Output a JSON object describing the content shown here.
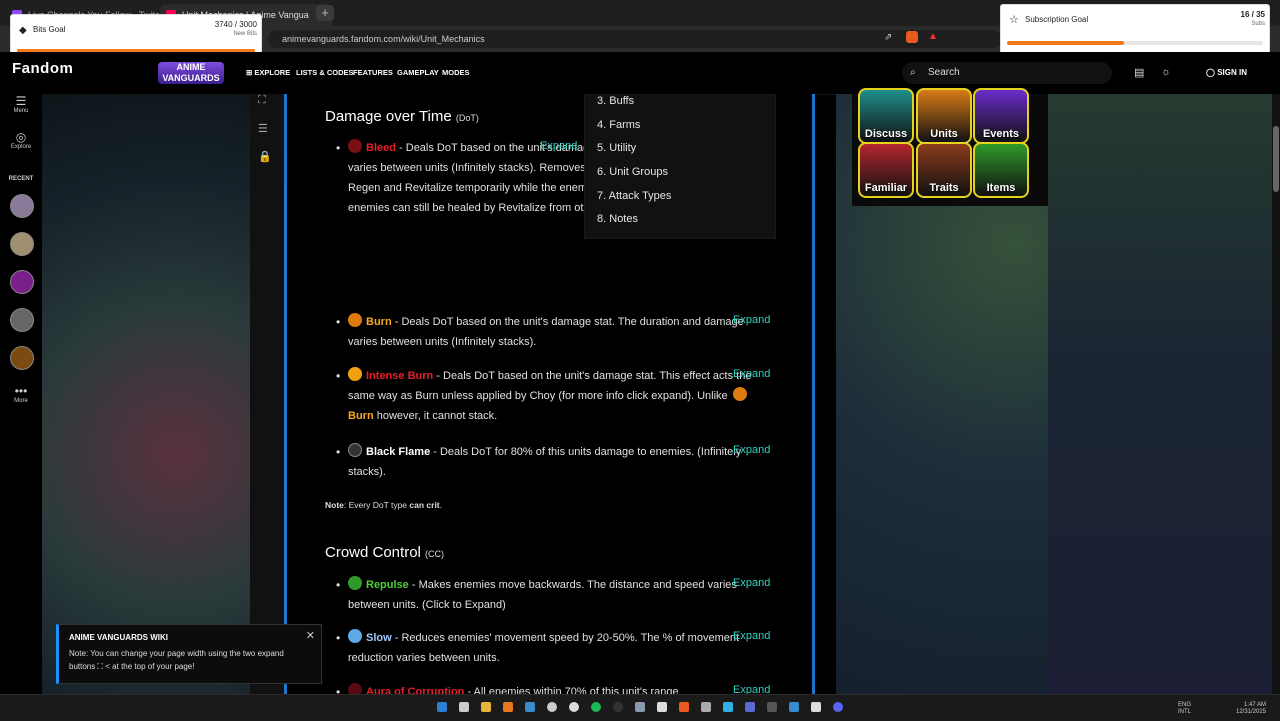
{
  "browser": {
    "tabs": [
      {
        "label": "Live Channels You Follow - Twitch"
      },
      {
        "label": "Unit Mechanics | Anime Vangua"
      }
    ],
    "url": "animevanguards.fandom.com/wiki/Unit_Mechanics"
  },
  "bits_goal": {
    "title": "Bits Goal",
    "count": "3740 / 3000",
    "sub": "New Bits",
    "progress": 1.0
  },
  "sub_goal": {
    "title": "Subscription Goal",
    "count": "16 / 35",
    "sub": "Subs",
    "progress": 0.457
  },
  "header": {
    "logo": "Fandom",
    "game_logo": "ANIME VANGUARDS",
    "nav": [
      "EXPLORE",
      "LISTS & CODES",
      "FEATURES",
      "GAMEPLAY",
      "MODES"
    ],
    "search_placeholder": "Search",
    "sign_in": "SIGN IN"
  },
  "rail": {
    "menu": "Menu",
    "explore": "Explore",
    "recent": "RECENT",
    "more": "More"
  },
  "toc": [
    {
      "num": "3.",
      "label": "Buffs"
    },
    {
      "num": "4.",
      "label": "Farms"
    },
    {
      "num": "5.",
      "label": "Utility"
    },
    {
      "num": "6.",
      "label": "Unit Groups"
    },
    {
      "num": "7.",
      "label": "Attack Types"
    },
    {
      "num": "8.",
      "label": "Notes"
    }
  ],
  "section_dot": {
    "title": "Damage over Time",
    "abbr": "(DoT)"
  },
  "entries_dot": [
    {
      "name": "Bleed",
      "text": " - Deals DoT based on the unit's damage stat. The duration and damage varies between units (Infinitely stacks). Removes enemies' ability to regenerate from Regen and Revitalize temporarily while the enemy has bleed applied. Bleeding enemies can still be healed by Revitalize from other enemies nearby.",
      "expand": "Expand"
    },
    {
      "name": "Burn",
      "text": " - Deals DoT based on the unit's damage stat. The duration and damage varies between units (Infinitely stacks).",
      "expand": "Expand"
    },
    {
      "name": "Intense Burn",
      "text": " - Deals DoT based on the unit's damage stat. This effect acts the same way as Burn unless applied by Choy (for more info click expand). Unlike ",
      "name2": "Burn",
      "text2": " however, it cannot stack.",
      "expand": "Expand"
    },
    {
      "name": "Black Flame",
      "text": " - Deals DoT for 80% of this units damage to enemies. (Infinitely stacks).",
      "expand": "Expand"
    }
  ],
  "note": {
    "label": "Note",
    "text": ": Every DoT type ",
    "bold": "can crit",
    "end": "."
  },
  "section_cc": {
    "title": "Crowd Control",
    "abbr": "(CC)"
  },
  "entries_cc": [
    {
      "name": "Repulse",
      "text": " - Makes enemies move backwards. The distance and speed varies between units. (Click to Expand)",
      "expand": "Expand"
    },
    {
      "name": "Slow",
      "text": " - Reduces enemies' movement speed by 20-50%. The % of movement reduction varies between units.",
      "expand": "Expand"
    },
    {
      "name": "Aura of Corruption",
      "text": " - All enemies within 70% of this unit's range",
      "expand": "Expand"
    }
  ],
  "tiles": [
    {
      "label": "Discuss",
      "color": "#1f8f8a"
    },
    {
      "label": "Units",
      "color": "#d97b16"
    },
    {
      "label": "Events",
      "color": "#6a2cc9"
    },
    {
      "label": "Familiar",
      "color": "#b3262e"
    },
    {
      "label": "Traits",
      "color": "#8a3b1d"
    },
    {
      "label": "Items",
      "color": "#2f9a2a"
    }
  ],
  "notice": {
    "title": "ANIME VANGUARDS WIKI",
    "text": "Note: You can change your page width using the two expand buttons ⛶ < at the top of your page!"
  },
  "tray": {
    "lang": "ENG",
    "layout": "INTL",
    "time": "1:47 AM",
    "date": "12/31/2025"
  }
}
